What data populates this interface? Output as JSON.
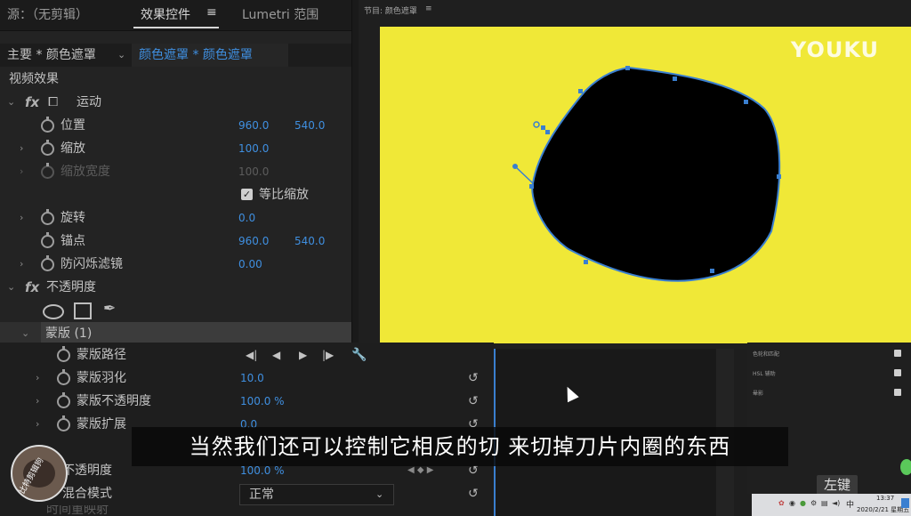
{
  "tabs": {
    "source": "源：（无剪辑）",
    "effects": "效果控件",
    "menu": "≡",
    "lumetri": "Lumetri 范围"
  },
  "clip_bar": {
    "master": "主要 * 颜色遮罩",
    "sequence": "颜色遮罩 * 颜色遮罩"
  },
  "section_video_effects": "视频效果",
  "motion": {
    "fx": "fx",
    "title": "运动",
    "position_label": "位置",
    "position_x": "960.0",
    "position_y": "540.0",
    "scale_label": "缩放",
    "scale_value": "100.0",
    "scale_width_label": "缩放宽度",
    "scale_width_value": "100.0",
    "uniform_label": "等比缩放",
    "rotation_label": "旋转",
    "rotation_value": "0.0",
    "anchor_label": "锚点",
    "anchor_x": "960.0",
    "anchor_y": "540.0",
    "flicker_label": "防闪烁滤镜",
    "flicker_value": "0.00"
  },
  "opacity": {
    "fx": "fx",
    "title": "不透明度",
    "mask_label": "蒙版 (1)",
    "mask_path_label": "蒙版路径",
    "mask_feather_label": "蒙版羽化",
    "mask_feather_value": "10.0",
    "mask_opacity_label": "蒙版不透明度",
    "mask_opacity_value": "100.0 %",
    "mask_expansion_label": "蒙版扩展",
    "mask_expansion_value": "0.0",
    "opacity_label": "不透明度",
    "opacity_value": "100.0 %",
    "blend_label": "混合模式",
    "blend_value": "正常",
    "time_remap_label": "时间重映射"
  },
  "monitor": {
    "title": "节目: 颜色遮罩",
    "menu": "≡",
    "watermark": "YOUKU"
  },
  "right_panel": {
    "item1": "色轮和匹配",
    "item2": "HSL 辅助",
    "item3": "晕影"
  },
  "subtitle": "当然我们还可以控制它相反的切 来切掉刀片内圈的东西",
  "key_hint": "左键",
  "avatar_text": "比特剪辑狗",
  "taskbar": {
    "time": "13:37",
    "date": "2020/2/21 星期五",
    "lang": "中"
  },
  "colors": {
    "accent_blue": "#3f8fe0",
    "video_bg": "#f0e837",
    "mask_outline": "#3a7fd0"
  }
}
